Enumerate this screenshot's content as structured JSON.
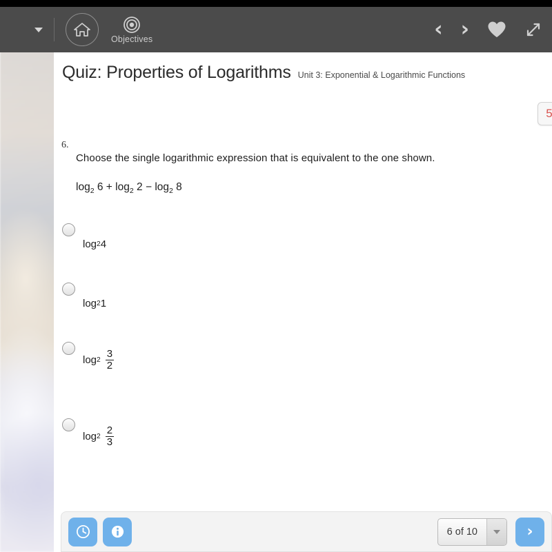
{
  "topbar": {
    "menu_caret": "menu-caret",
    "home_icon": "home-icon",
    "objectives_icon": "target-icon",
    "objectives_label": "Objectives",
    "back_icon": "‹",
    "forward_icon": "›",
    "favorite_icon": "heart-icon",
    "fullscreen_icon": "expand-icon",
    "bar_color": "#4b4b4b"
  },
  "header": {
    "title": "Quiz: Properties of Logarithms",
    "subtitle": "Unit 3: Exponential & Logarithmic Functions"
  },
  "badge": {
    "value": "5",
    "color": "#d9534f"
  },
  "question": {
    "number": "6.",
    "prompt": "Choose the single logarithmic expression that is equivalent to the one shown.",
    "expression_parts": [
      {
        "base_label": "log",
        "base": "2",
        "arg": "6"
      },
      {
        "op": "+"
      },
      {
        "base_label": "log",
        "base": "2",
        "arg": "2"
      },
      {
        "op": "−"
      },
      {
        "base_label": "log",
        "base": "2",
        "arg": "8"
      }
    ],
    "expression_text": "log2 6 + log2 2 − log2 8"
  },
  "options": [
    {
      "id": "a",
      "log_label": "log",
      "base": "2",
      "value": "4",
      "type": "plain",
      "selected": false
    },
    {
      "id": "b",
      "log_label": "log",
      "base": "2",
      "value": "1",
      "type": "plain",
      "selected": false
    },
    {
      "id": "c",
      "log_label": "log",
      "base": "2",
      "numerator": "3",
      "denominator": "2",
      "type": "fraction",
      "selected": false
    },
    {
      "id": "d",
      "log_label": "log",
      "base": "2",
      "numerator": "2",
      "denominator": "3",
      "type": "fraction",
      "selected": false
    }
  ],
  "toolbar": {
    "clock_icon": "clock-icon",
    "info_icon": "info-icon",
    "pager_label": "6 of 10",
    "pager_caret": "chevron-down-icon",
    "next_icon": "›",
    "button_color": "#6fb1ea"
  }
}
